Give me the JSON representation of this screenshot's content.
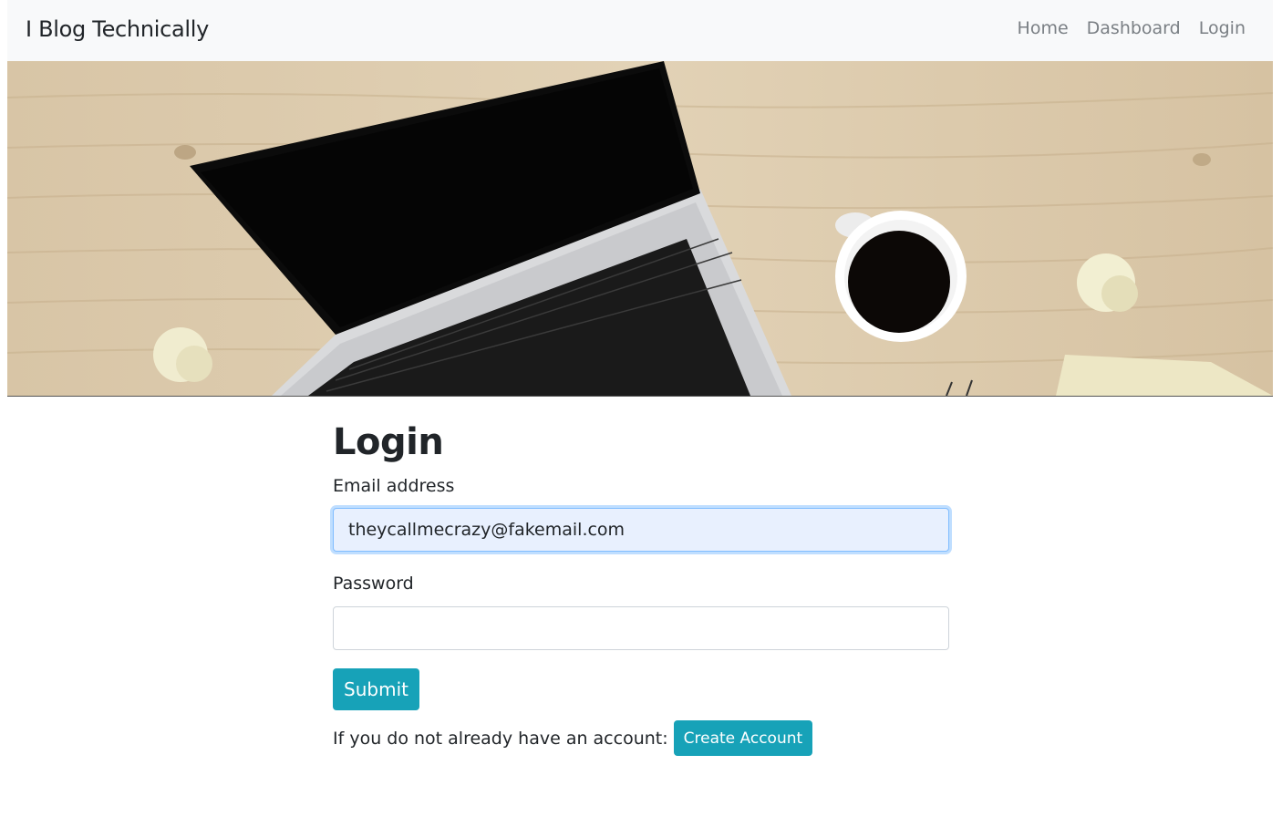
{
  "navbar": {
    "brand": "I Blog Technically",
    "links": [
      {
        "label": "Home"
      },
      {
        "label": "Dashboard"
      },
      {
        "label": "Login"
      }
    ]
  },
  "hero": {
    "description": "laptop-coffee-desk-banner"
  },
  "login": {
    "title": "Login",
    "email_label": "Email address",
    "email_value": "theycallmecrazy@fakemail.com",
    "password_label": "Password",
    "password_value": "",
    "submit_label": "Submit",
    "signup_prompt": "If you do not already have an account:",
    "create_account_label": "Create Account"
  },
  "colors": {
    "accent": "#17a2b8",
    "navbar_bg": "#f8f9fa",
    "focus_bg": "#e8f0fe"
  }
}
